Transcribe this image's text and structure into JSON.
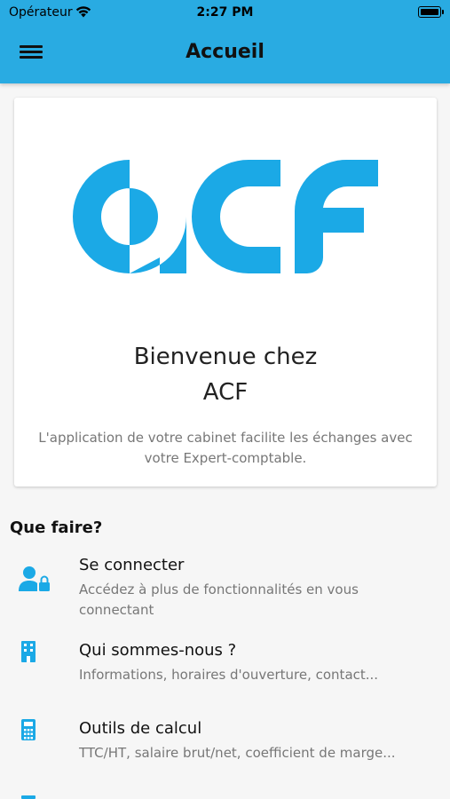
{
  "status_bar": {
    "carrier": "Opérateur",
    "time": "2:27 PM",
    "wifi_icon": "wifi-icon",
    "battery_icon": "battery-icon"
  },
  "nav": {
    "title": "Accueil",
    "menu_icon": "hamburger-menu-icon"
  },
  "welcome_card": {
    "logo_text": "ACF",
    "line1": "Bienvenue chez",
    "line2": "ACF",
    "description": "L'application de votre cabinet facilite les échanges avec votre Expert-comptable."
  },
  "section": {
    "title": "Que faire?"
  },
  "items": [
    {
      "icon": "user-lock-icon",
      "title": "Se connecter",
      "subtitle": "Accédez à plus de fonctionnalités en vous connectant"
    },
    {
      "icon": "building-icon",
      "title": "Qui sommes-nous ?",
      "subtitle": "Informations, horaires d'ouverture, contact..."
    },
    {
      "icon": "calculator-icon",
      "title": "Outils de calcul",
      "subtitle": "TTC/HT, salaire brut/net, coefficient de marge..."
    }
  ],
  "colors": {
    "brand_blue": "#29abe2",
    "logo_blue": "#1ba9e6",
    "background": "#f6f6f6"
  }
}
